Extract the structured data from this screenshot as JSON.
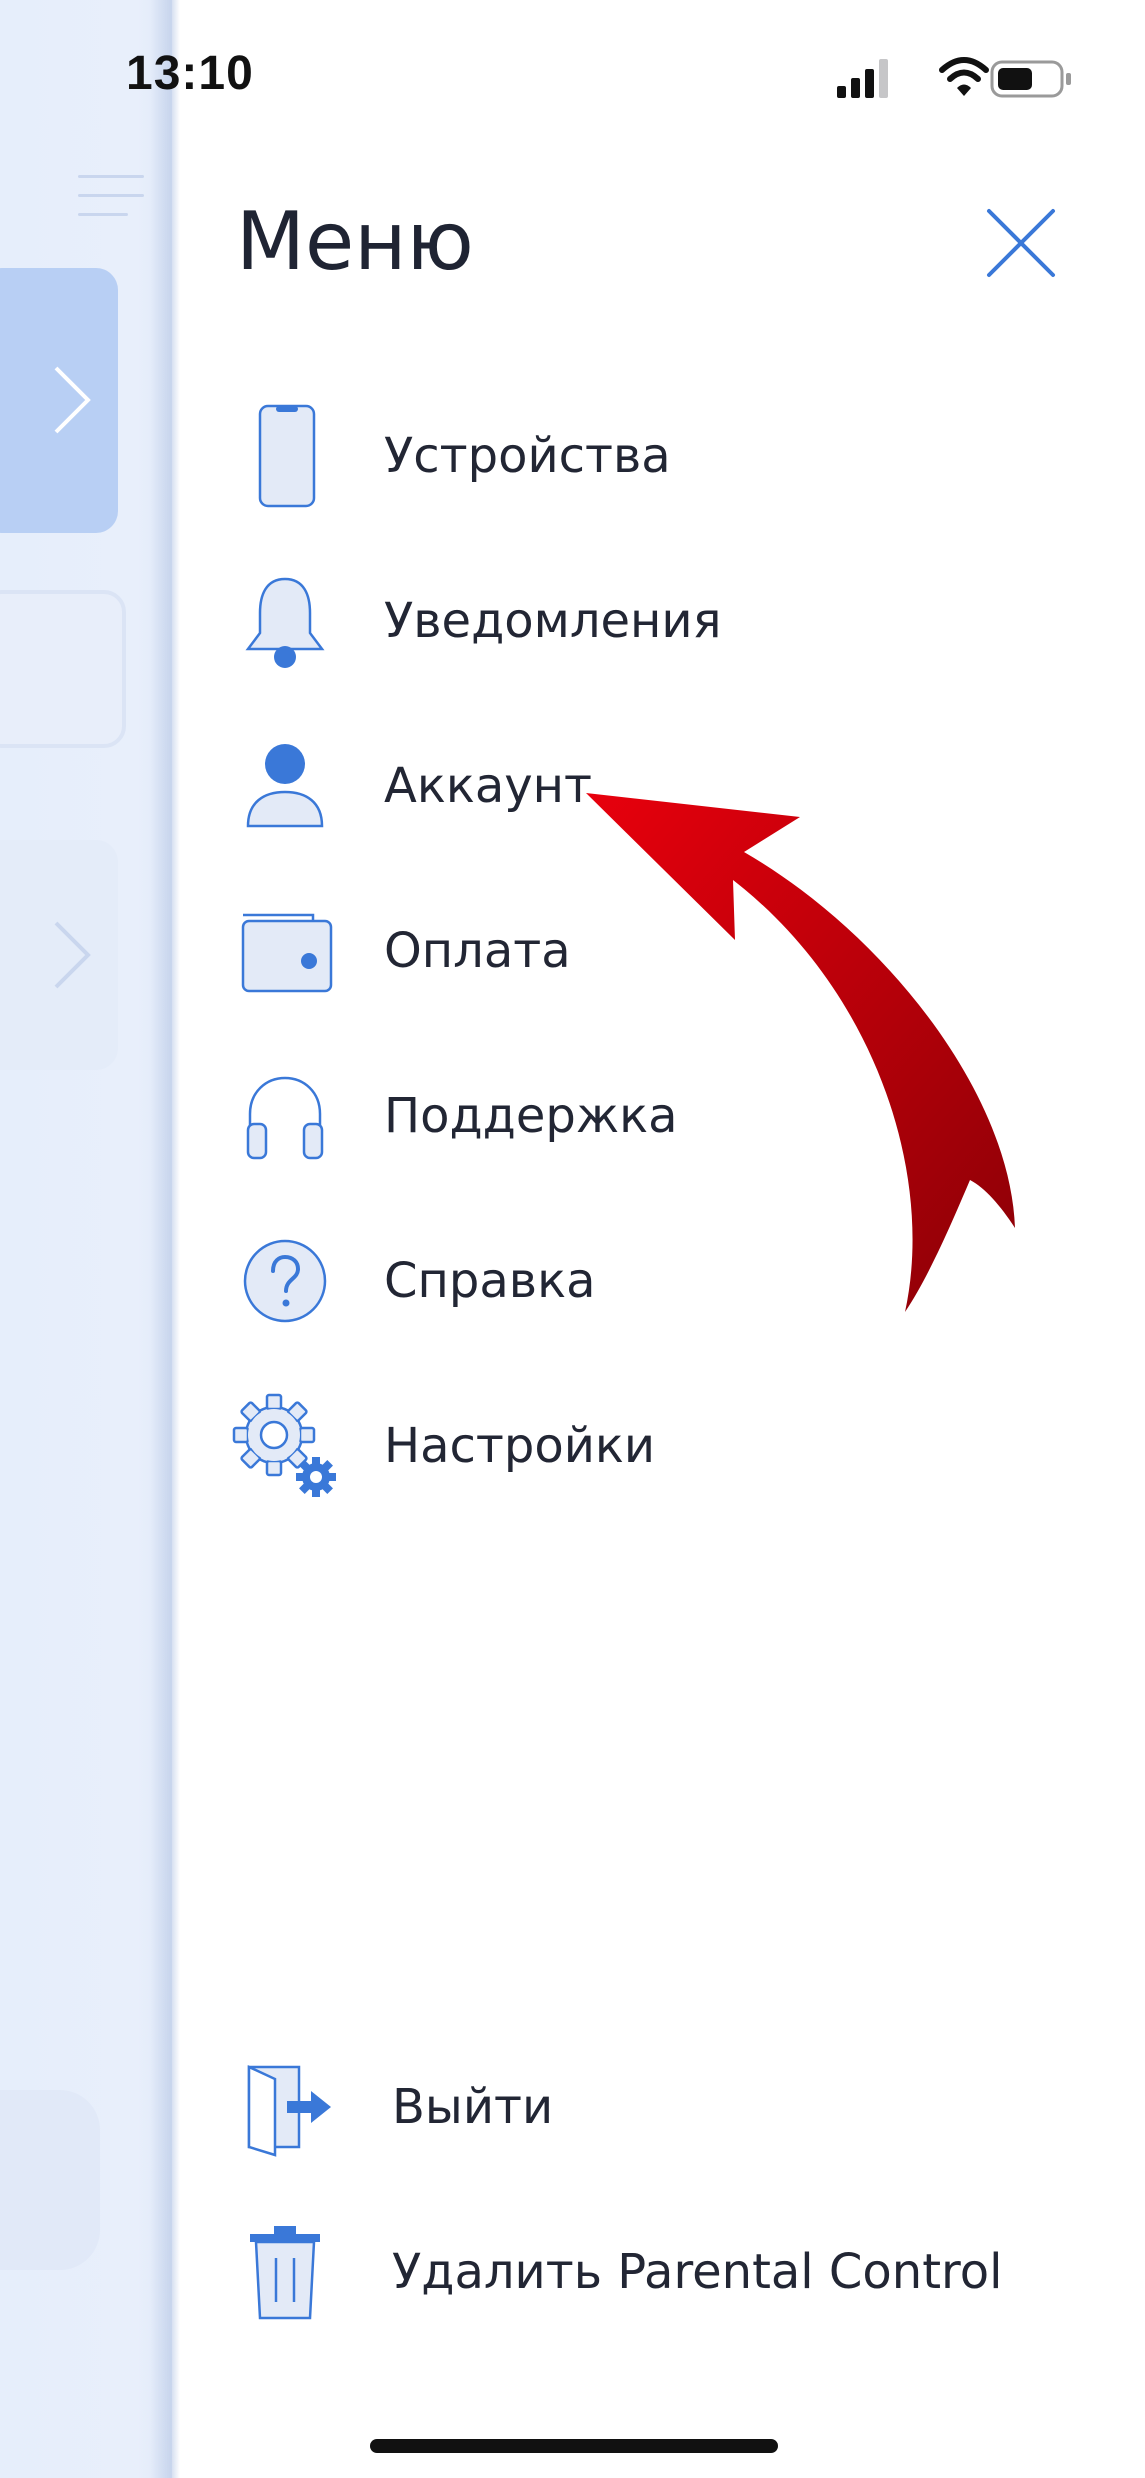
{
  "status_bar": {
    "time": "13:10"
  },
  "menu": {
    "title": "Меню",
    "items": [
      {
        "label": "Устройства",
        "icon": "phone-icon"
      },
      {
        "label": "Уведомления",
        "icon": "bell-icon"
      },
      {
        "label": "Аккаунт",
        "icon": "user-icon"
      },
      {
        "label": "Оплата",
        "icon": "wallet-icon"
      },
      {
        "label": "Поддержка",
        "icon": "headphones-icon"
      },
      {
        "label": "Справка",
        "icon": "help-icon"
      },
      {
        "label": "Настройки",
        "icon": "gear-icon"
      }
    ],
    "bottom_items": [
      {
        "label": "Выйти",
        "icon": "logout-icon"
      },
      {
        "label": "Удалить Parental Control",
        "icon": "trash-icon"
      }
    ]
  },
  "colors": {
    "accent": "#3a78d8",
    "icon_fill": "#e3eaf7",
    "arrow": "#c8000a"
  }
}
